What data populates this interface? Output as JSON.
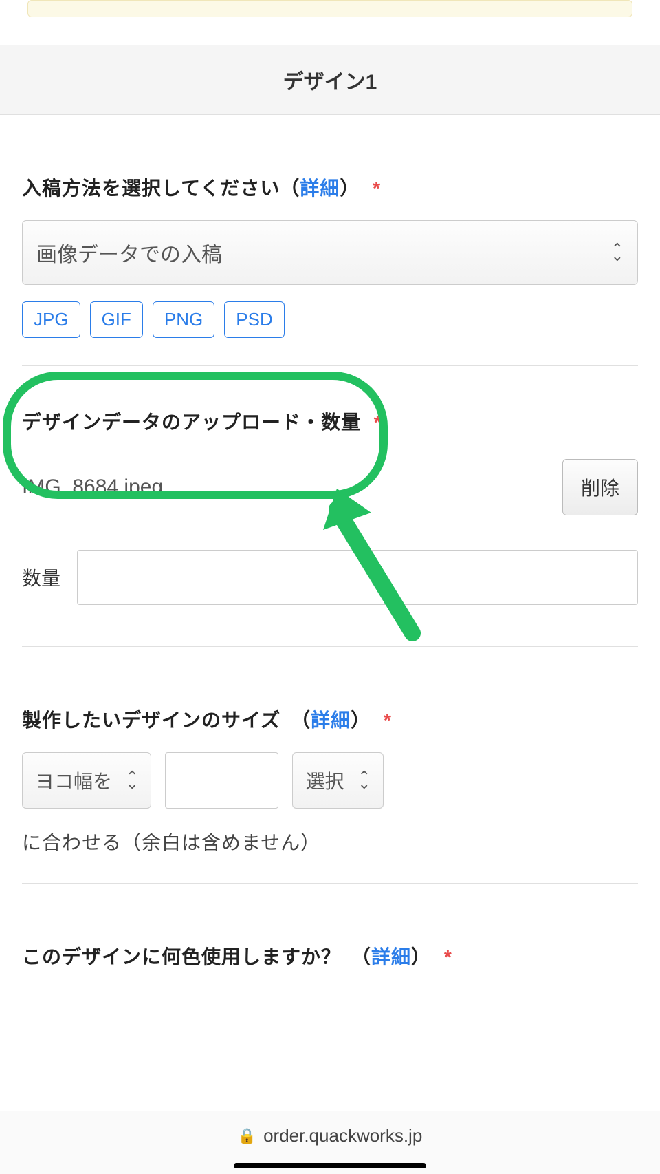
{
  "header": {
    "title": "デザイン1"
  },
  "method": {
    "label_prefix": "入稿方法を選択してください（",
    "detail": "詳細",
    "label_suffix": "）",
    "required": "*",
    "selected": "画像データでの入稿",
    "tags": [
      "JPG",
      "GIF",
      "PNG",
      "PSD"
    ]
  },
  "upload": {
    "label": "デザインデータのアップロード・数量",
    "required": "*",
    "file_name": "IMG_8684.jpeg",
    "delete": "削除",
    "qty_label": "数量"
  },
  "size": {
    "label_prefix": "製作したいデザインのサイズ　（",
    "detail": "詳細",
    "label_suffix": "）",
    "required": "*",
    "dim_select": "ヨコ幅を",
    "unit_select": "選択",
    "note": "に合わせる（余白は含めません）"
  },
  "colors": {
    "label_prefix": "このデザインに何色使用しますか？　（",
    "detail": "詳細",
    "label_suffix": "）",
    "required": "*"
  },
  "footer": {
    "url": "order.quackworks.jp"
  }
}
